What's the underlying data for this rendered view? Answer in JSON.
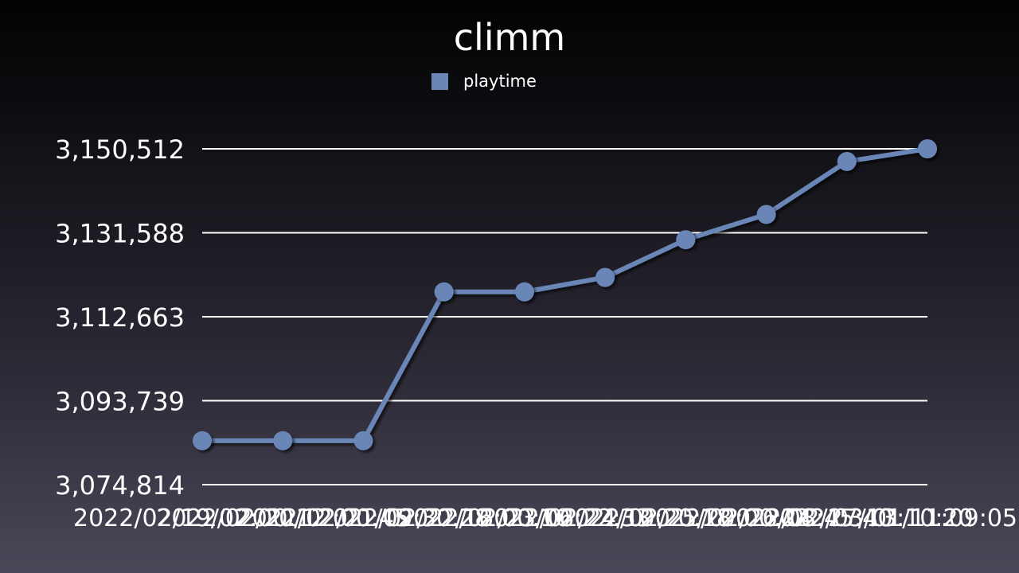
{
  "chart_data": {
    "type": "line",
    "title": "climm",
    "xlabel": "",
    "ylabel": "",
    "legend_position": "top-center",
    "grid": true,
    "categories": [
      "2022/02/19/02:00:12",
      "2022/02/20/12:00:45",
      "2022/02/21/09:30:28",
      "2022/02/22/16:00:10",
      "2022/02/23/06:22:33",
      "2022/02/24/10:20:18",
      "2022/02/25/20:00:24",
      "2022/02/26/08:45:40",
      "2022/02/27/13:10:20",
      "2022/03/01/11:09:05"
    ],
    "series": [
      {
        "name": "playtime",
        "color": "#6a86b6",
        "values": [
          3084719,
          3084719,
          3084719,
          3118271,
          3118271,
          3121523,
          3130026,
          3135722,
          3147652,
          3150512
        ]
      }
    ],
    "yticks": [
      "3,074,814",
      "3,093,739",
      "3,112,663",
      "3,131,588",
      "3,150,512"
    ],
    "ytick_values": [
      3074814,
      3093739,
      3112663,
      3131588,
      3150512
    ],
    "ylim": [
      3074814,
      3150512
    ]
  }
}
